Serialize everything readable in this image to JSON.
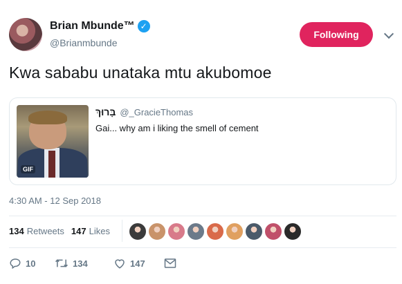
{
  "author": {
    "name": "Brian Mbunde™",
    "handle": "@Brianmbunde",
    "verified_mark": "✓",
    "follow_label": "Following"
  },
  "tweet": {
    "text": "Kwa sababu unataka mtu akubomoe",
    "timestamp": "4:30 AM - 12 Sep 2018"
  },
  "quote": {
    "name": "בָּרוּךְ",
    "handle": "@_GracieThomas",
    "text": "Gai... why am i liking the smell of cement",
    "media_badge": "GIF"
  },
  "stats": {
    "retweets_count": "134",
    "retweets_label": "Retweets",
    "likes_count": "147",
    "likes_label": "Likes"
  },
  "likers": [
    {
      "color": "#3b3b3b"
    },
    {
      "color": "#c9936a"
    },
    {
      "color": "#d87a8a"
    },
    {
      "color": "#6b7a8a"
    },
    {
      "color": "#d96a4a"
    },
    {
      "color": "#e0a060"
    },
    {
      "color": "#4a5a6a"
    },
    {
      "color": "#c0506a"
    },
    {
      "color": "#2a2a2a"
    }
  ],
  "actions": {
    "replies": "10",
    "retweets": "134",
    "likes": "147"
  },
  "colors": {
    "accent": "#1da1f2",
    "following_bg": "#e0245e",
    "muted": "#657786"
  }
}
